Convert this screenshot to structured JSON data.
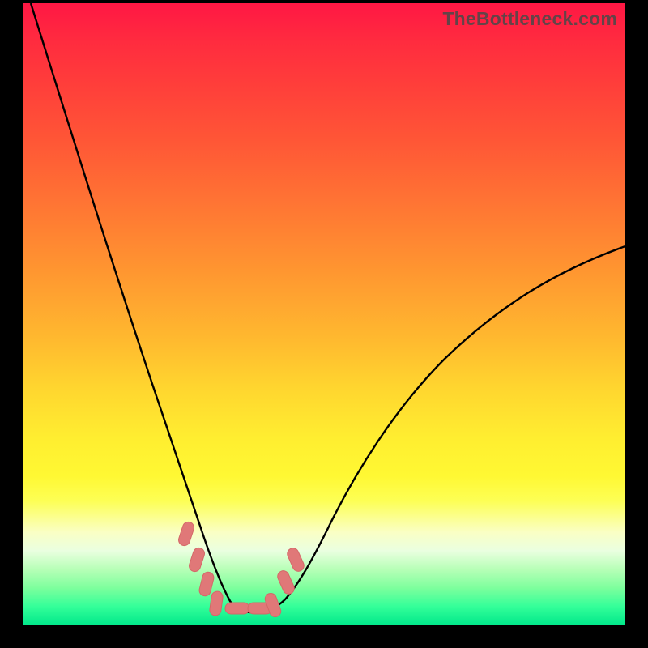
{
  "watermark": "TheBottleneck.com",
  "colors": {
    "frame": "#000000",
    "curve_stroke": "#000000",
    "marker_fill": "#e88080",
    "marker_stroke": "#d86a6a"
  },
  "chart_data": {
    "type": "line",
    "title": "",
    "xlabel": "",
    "ylabel": "",
    "x": [
      0.0,
      0.05,
      0.1,
      0.15,
      0.2,
      0.24,
      0.27,
      0.3,
      0.32,
      0.34,
      0.36,
      0.38,
      0.4,
      0.43,
      0.47,
      0.52,
      0.6,
      0.7,
      0.8,
      0.9,
      1.0
    ],
    "values": [
      1.0,
      0.86,
      0.72,
      0.56,
      0.38,
      0.22,
      0.12,
      0.06,
      0.03,
      0.02,
      0.02,
      0.02,
      0.03,
      0.05,
      0.09,
      0.14,
      0.22,
      0.31,
      0.38,
      0.44,
      0.49
    ],
    "xlim": [
      0,
      1
    ],
    "ylim": [
      0,
      1
    ],
    "markers": {
      "type": "pill",
      "color": "#e88080",
      "positions_x": [
        0.259,
        0.277,
        0.294,
        0.312,
        0.335,
        0.362,
        0.392,
        0.418,
        0.432
      ],
      "positions_y": [
        0.135,
        0.09,
        0.055,
        0.03,
        0.02,
        0.02,
        0.028,
        0.055,
        0.09
      ]
    }
  }
}
